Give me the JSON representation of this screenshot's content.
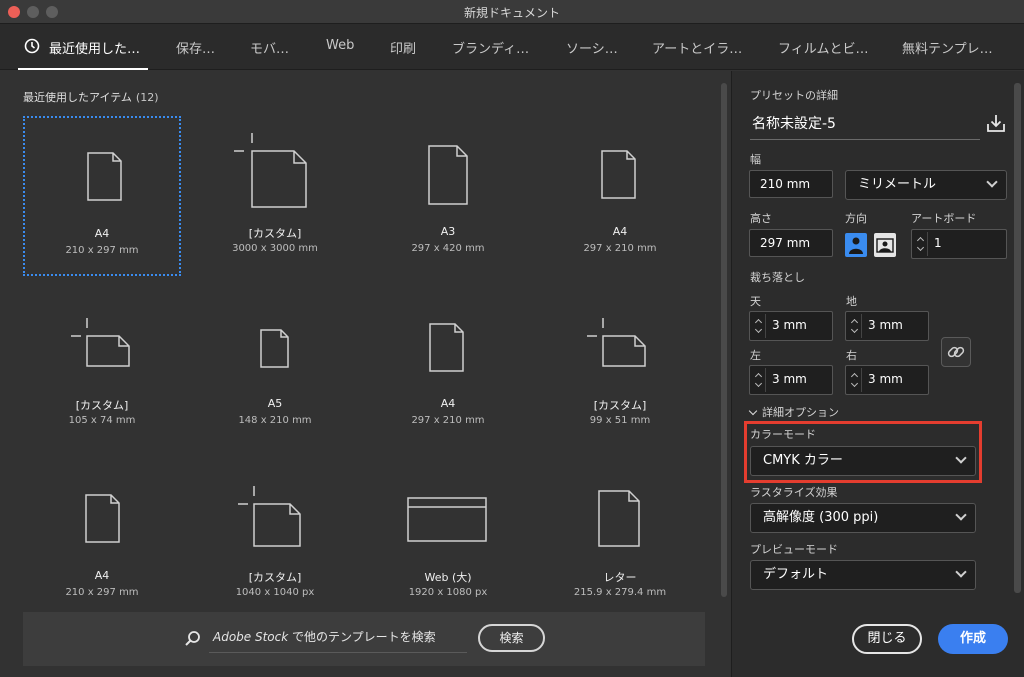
{
  "window": {
    "title": "新規ドキュメント"
  },
  "tabs": [
    {
      "label": "最近使用した…"
    },
    {
      "label": "保存…"
    },
    {
      "label": "モバ…"
    },
    {
      "label": "Web"
    },
    {
      "label": "印刷"
    },
    {
      "label": "ブランディ…"
    },
    {
      "label": "ソーシ…"
    },
    {
      "label": "アートとイラ…"
    },
    {
      "label": "フィルムとビ…"
    },
    {
      "label": "無料テンプレ…"
    }
  ],
  "gallery": {
    "title": "最近使用したアイテム",
    "count": "(12)",
    "items": [
      {
        "name": "A4",
        "size": "210 x 297 mm"
      },
      {
        "name": "[カスタム]",
        "size": "3000 x 3000 mm"
      },
      {
        "name": "A3",
        "size": "297 x 420 mm"
      },
      {
        "name": "A4",
        "size": "297 x 210 mm"
      },
      {
        "name": "[カスタム]",
        "size": "105 x 74 mm"
      },
      {
        "name": "A5",
        "size": "148 x 210 mm"
      },
      {
        "name": "A4",
        "size": "297 x 210 mm"
      },
      {
        "name": "[カスタム]",
        "size": "99 x 51 mm"
      },
      {
        "name": "A4",
        "size": "210 x 297 mm"
      },
      {
        "name": "[カスタム]",
        "size": "1040 x 1040 px"
      },
      {
        "name": "Web (大)",
        "size": "1920 x 1080 px"
      },
      {
        "name": "レター",
        "size": "215.9 x 279.4 mm"
      }
    ]
  },
  "stock": {
    "brand": "Adobe Stock",
    "text": " で他のテンプレートを検索",
    "button": "検索"
  },
  "preset": {
    "section_label": "プリセットの詳細",
    "name": "名称未設定-5",
    "width_label": "幅",
    "width": "210 mm",
    "unit": "ミリメートル",
    "height_label": "高さ",
    "height": "297 mm",
    "orientation_label": "方向",
    "artboard_label": "アートボード",
    "artboards": "1",
    "bleed_label": "裁ち落とし",
    "bleed": {
      "top_label": "天",
      "top": "3 mm",
      "bottom_label": "地",
      "bottom": "3 mm",
      "left_label": "左",
      "left": "3 mm",
      "right_label": "右",
      "right": "3 mm"
    },
    "advanced_label": "詳細オプション",
    "color_mode_label": "カラーモード",
    "color_mode": "CMYK カラー",
    "raster_label": "ラスタライズ効果",
    "raster": "高解像度 (300 ppi)",
    "preview_label": "プレビューモード",
    "preview": "デフォルト"
  },
  "actions": {
    "close": "閉じる",
    "create": "作成"
  },
  "colors": {
    "accent": "#3a7ff0",
    "highlight": "#e43d2f",
    "selection": "#3a8cf0"
  }
}
